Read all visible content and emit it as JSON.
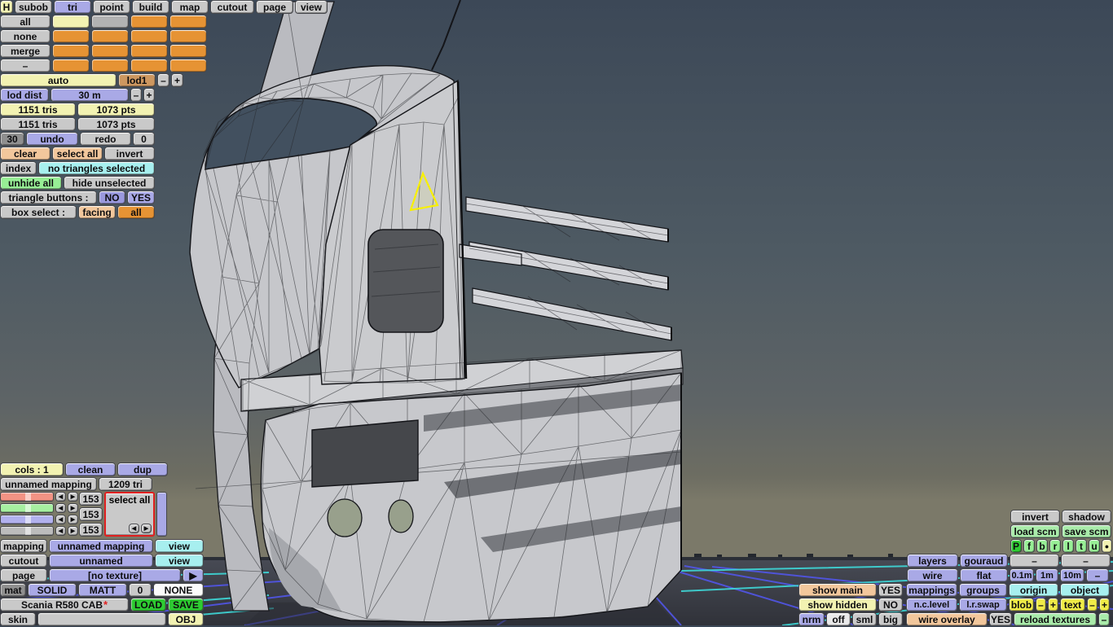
{
  "colors": {
    "panel_gray": "#c9c9c9",
    "lavender": "#a9a9e6",
    "lavender_active": "#9a99de",
    "pale_yellow": "#f2f2b2",
    "orange": "#e69334",
    "tan": "#cd9760",
    "peach": "#f2c79c",
    "cyan": "#a7efef",
    "green": "#97ee95",
    "bright_green": "#2ecb32",
    "light_green": "#a9ebaa",
    "yellow": "#f0ec48",
    "white": "#fbfbfb",
    "dark_gray": "#8f8f8f",
    "off_white": "#e9e9e9",
    "salmon": "#f29384",
    "swatch_green": "#a6efa0",
    "swatch_lavender": "#b2b1ee",
    "swatch_gray": "#bcbcbc",
    "red": "#e02020",
    "selection_yellow": "#f8f000",
    "grid_blue": "#5155e8",
    "grid_cyan": "#3ed8d8",
    "edge": "#17181b",
    "body_gray": "#c7c8cc"
  },
  "icons": {
    "left": "◀",
    "right": "▶",
    "play": "▶",
    "dot": "●"
  },
  "ui": {
    "minus": "–",
    "plus": "+"
  },
  "toolbar": {
    "items": [
      "H",
      "subob",
      "tri",
      "point",
      "build",
      "map",
      "cutout",
      "page",
      "view"
    ]
  },
  "subobj": {
    "row_labels": [
      "all",
      "none",
      "merge",
      "–"
    ],
    "grid": [
      [
        "yellow",
        "gray",
        "orange",
        "orange"
      ],
      [
        "orange",
        "orange",
        "orange",
        "orange"
      ],
      [
        "orange",
        "orange",
        "orange",
        "orange"
      ],
      [
        "orange",
        "orange",
        "orange",
        "orange"
      ]
    ]
  },
  "lod": {
    "auto": "auto",
    "level": "lod1",
    "dist_label": "lod dist",
    "dist_value": "30 m"
  },
  "stats": {
    "tris_sel": "1151 tris",
    "pts_sel": "1073 pts",
    "tris": "1151 tris",
    "pts": "1073 pts",
    "undo_count": "30",
    "undo": "undo",
    "redo": "redo",
    "redo_count": "0"
  },
  "selection": {
    "clear": "clear",
    "select_all": "select all",
    "invert": "invert",
    "index": "index",
    "status": "no triangles selected",
    "unhide_all": "unhide all",
    "hide_unselected": "hide unselected",
    "triangle_buttons_label": "triangle buttons :",
    "no": "NO",
    "yes": "YES",
    "box_select_label": "box select :",
    "facing": "facing",
    "all": "all"
  },
  "mapping_panel": {
    "cols": "cols : 1",
    "clean": "clean",
    "dup": "dup",
    "name": "unnamed mapping",
    "tri_count": "1209 tri",
    "select_all": "select all",
    "values": [
      "153",
      "153",
      "153"
    ],
    "channels": [
      {
        "color": "salmon"
      },
      {
        "color": "green"
      },
      {
        "color": "lavender"
      },
      {
        "color": "gray"
      }
    ]
  },
  "texture_panel": {
    "mapping_label": "mapping",
    "mapping_value": "unnamed mapping",
    "view": "view",
    "cutout_label": "cutout",
    "cutout_value": "unnamed",
    "page_label": "page",
    "page_value": "[no texture]",
    "mat_label": "mat",
    "mat_type": "SOLID",
    "mat_shading": "MATT",
    "mat_num": "0",
    "mat_tex": "NONE",
    "model_name": "Scania R580 CAB",
    "model_star": "*",
    "load": "LOAD",
    "save": "SAVE",
    "skin": "skin",
    "obj": "OBJ"
  },
  "right_panel": {
    "invert": "invert",
    "shadow": "shadow",
    "load_scm": "load scm",
    "save_scm": "save scm",
    "proj": [
      "P",
      "f",
      "b",
      "r",
      "l",
      "t",
      "u"
    ],
    "layers": "layers",
    "gouraud": "gouraud",
    "wire": "wire",
    "flat": "flat",
    "d01": "0.1m",
    "d1": "1m",
    "d10": "10m",
    "mappings": "mappings",
    "groups": "groups",
    "origin": "origin",
    "object": "object",
    "ncl": "n.c.level",
    "lrswap": "l.r.swap",
    "blob": "blob",
    "text": "text",
    "show_main": "show main",
    "show_hidden": "show hidden",
    "yes": "YES",
    "no": "NO",
    "nrm": "nrm",
    "off": "off",
    "sml": "sml",
    "big": "big",
    "wire_overlay": "wire overlay",
    "reload": "reload textures"
  }
}
